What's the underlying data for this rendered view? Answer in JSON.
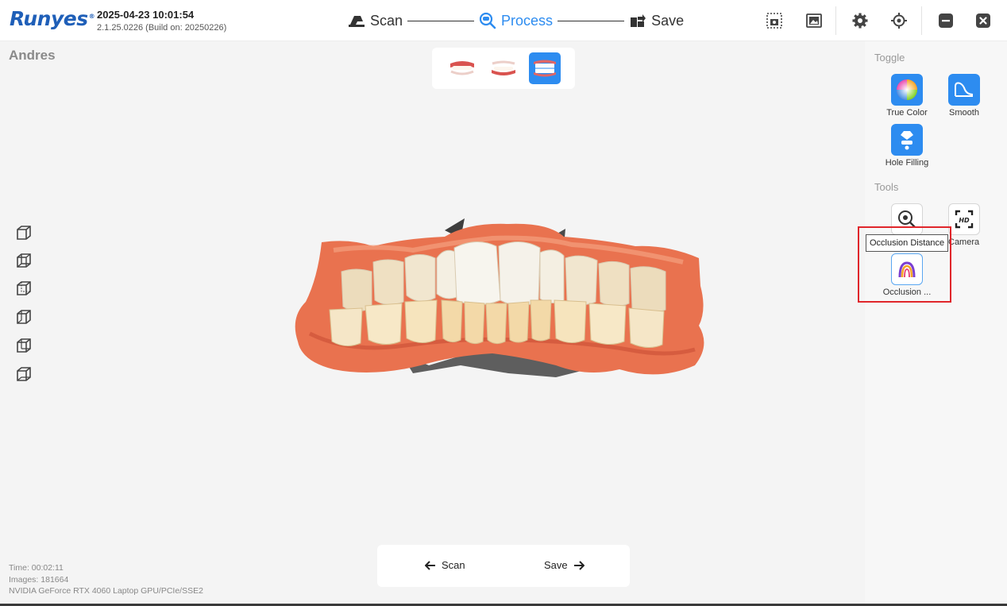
{
  "header": {
    "logo": "Runyes",
    "logo_mark": "®",
    "datetime": "2025-04-23 10:01:54",
    "version": "2.1.25.0226 (Build on: 20250226)",
    "steps": [
      {
        "label": "Scan",
        "icon": "scanner-icon",
        "active": false
      },
      {
        "label": "Process",
        "icon": "process-icon",
        "active": true
      },
      {
        "label": "Save",
        "icon": "save-icon",
        "active": false
      }
    ],
    "icons": [
      "screenshot-icon",
      "gallery-icon",
      "settings-icon",
      "target-icon",
      "minimize-icon",
      "close-icon"
    ]
  },
  "patient": {
    "name": "Andres"
  },
  "view_switch": {
    "options": [
      "upper-jaw-view",
      "lower-jaw-view",
      "both-jaws-view"
    ],
    "active": "both-jaws-view"
  },
  "view_cubes": [
    "view-front",
    "view-back",
    "view-left",
    "view-right",
    "view-top",
    "view-bottom"
  ],
  "right_panel": {
    "toggle_title": "Toggle",
    "toggles": [
      {
        "label": "True Color",
        "icon": "true-color-icon"
      },
      {
        "label": "Smooth",
        "icon": "smooth-icon"
      },
      {
        "label": "Hole Filling",
        "icon": "hole-filling-icon"
      }
    ],
    "tools_title": "Tools",
    "tools": [
      {
        "label": "",
        "icon": "occlusion-distance-icon"
      },
      {
        "label": "D Camera",
        "icon": "hd-camera-icon"
      },
      {
        "label": "Occlusion ...",
        "icon": "occlusion-icon"
      }
    ],
    "tooltip": "Occlusion Distance"
  },
  "bottom_nav": {
    "back_label": "Scan",
    "next_label": "Save"
  },
  "status": {
    "time": "Time: 00:02:11",
    "images": "Images: 181664",
    "gpu": "NVIDIA GeForce RTX 4060 Laptop GPU/PCIe/SSE2"
  },
  "colors": {
    "accent": "#2d8cf0",
    "brand": "#1f5fb8",
    "highlight": "#e0262b"
  }
}
